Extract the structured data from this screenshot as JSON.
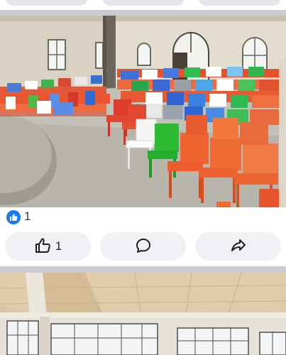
{
  "post": {
    "reactions": {
      "icon": "like-icon",
      "count": "1"
    },
    "actions": {
      "like": {
        "icon": "thumbs-up-icon",
        "count": "1"
      },
      "comment": {
        "icon": "comment-bubble-icon"
      },
      "share": {
        "icon": "share-arrow-icon"
      }
    }
  },
  "colors": {
    "like_blue": "#1877f2",
    "button_bg": "#eff1f4",
    "divider": "#c9ccd1"
  }
}
